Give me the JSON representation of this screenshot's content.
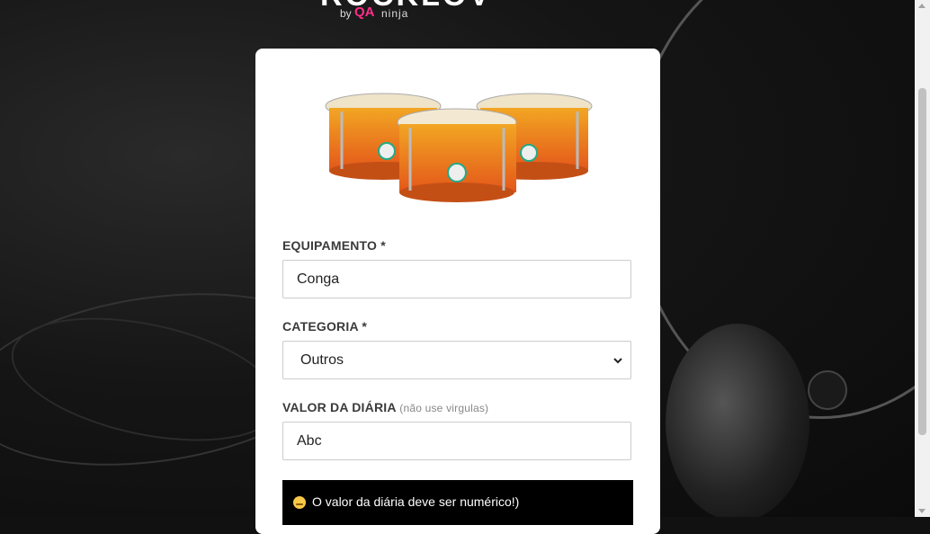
{
  "brand": {
    "logo_main": "ROCKLOV",
    "logo_by": "by",
    "logo_qa": "QA",
    "logo_ninja": "ninja",
    "accent": "#ff2d8a"
  },
  "product": {
    "image_alt": "conga-drums-image"
  },
  "form": {
    "equipment_label": "EQUIPAMENTO *",
    "equipment_value": "Conga",
    "category_label": "CATEGORIA *",
    "category_value": "Outros",
    "price_label": "VALOR DA DIÁRIA",
    "price_hint": "(não use virgulas)",
    "price_value": "Abc"
  },
  "alert": {
    "message": "O valor da diária deve ser numérico!)"
  }
}
